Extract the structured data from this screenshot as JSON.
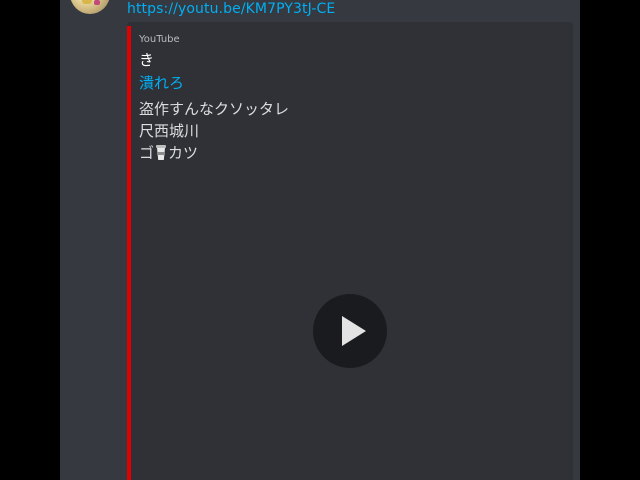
{
  "message": {
    "link_text": "https://youtu.be/KM7PY3tJ-CE"
  },
  "embed": {
    "provider": "YouTube",
    "author": "き",
    "title": "潰れろ",
    "description_lines": [
      "盗作すんなクソッタレ",
      "尺西城川"
    ],
    "description_line3_prefix": "ゴ",
    "description_line3_suffix": "カツ",
    "accent_color": "#e00000"
  },
  "icons": {
    "play": "play-icon",
    "cup": "cup-emoji-icon"
  }
}
